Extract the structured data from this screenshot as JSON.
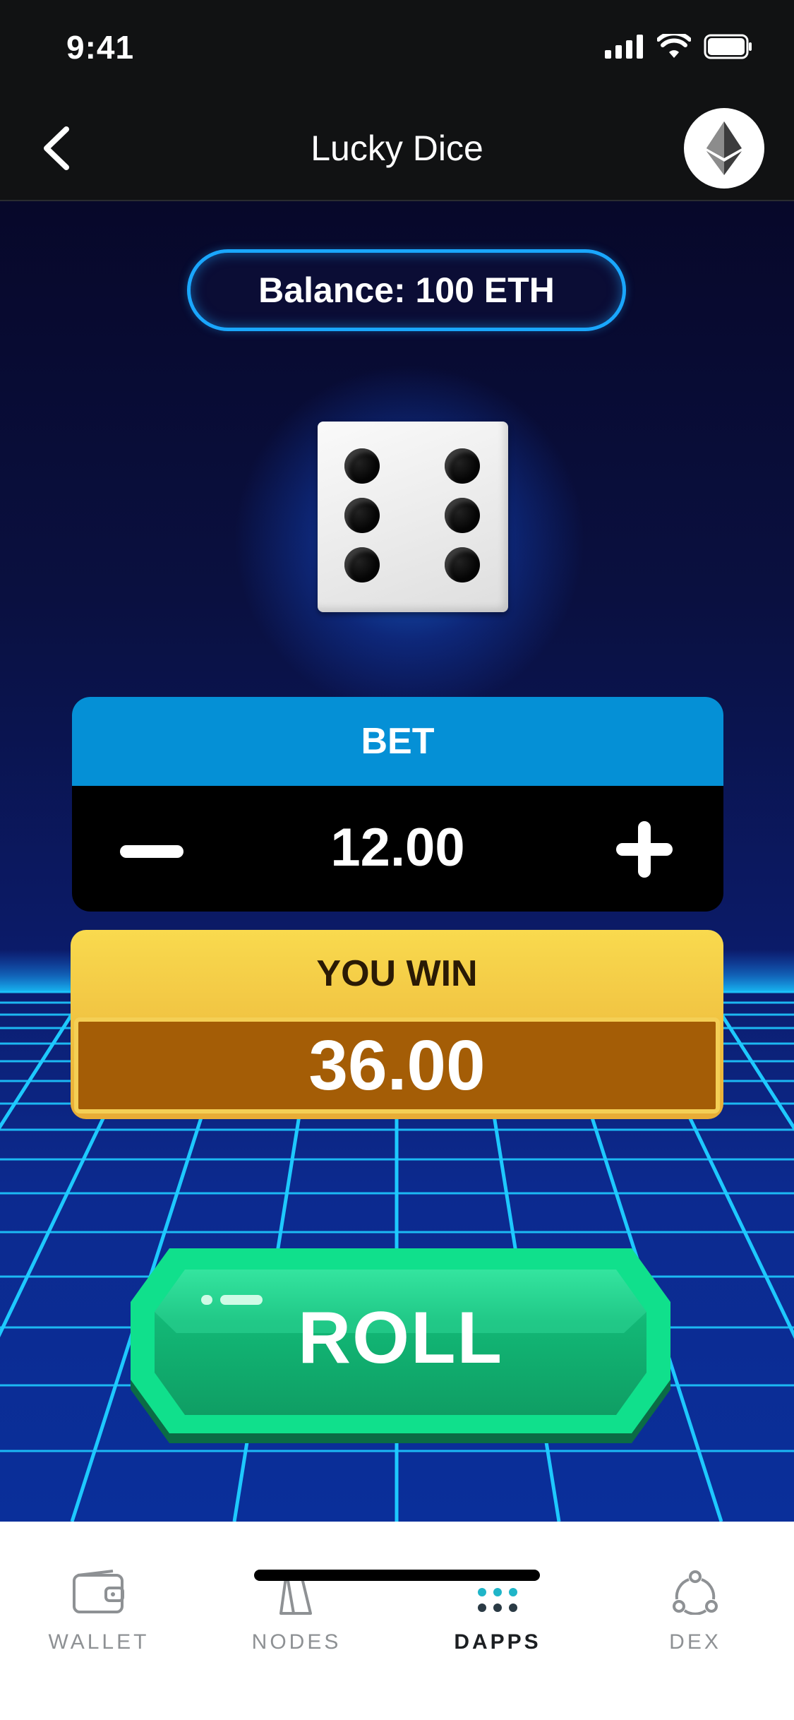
{
  "status_bar": {
    "time": "9:41"
  },
  "nav": {
    "title": "Lucky Dice"
  },
  "balance": {
    "label": "Balance: 100 ETH"
  },
  "dice": {
    "face_value": 6
  },
  "bet": {
    "header": "BET",
    "value": "12.00"
  },
  "win": {
    "header": "YOU WIN",
    "value": "36.00"
  },
  "roll": {
    "label": "ROLL"
  },
  "tabs": [
    {
      "label": "WALLET",
      "icon": "wallet-icon",
      "active": false
    },
    {
      "label": "NODES",
      "icon": "nodes-icon",
      "active": false
    },
    {
      "label": "DAPPS",
      "icon": "dapps-icon",
      "active": true
    },
    {
      "label": "DEX",
      "icon": "dex-icon",
      "active": false
    }
  ],
  "colors": {
    "bet_header": "#0590d6",
    "win_gold": "#f9da4e",
    "win_value_bg": "#a45d06",
    "roll_green": "#10d688",
    "grid_line": "#18c8ff"
  }
}
